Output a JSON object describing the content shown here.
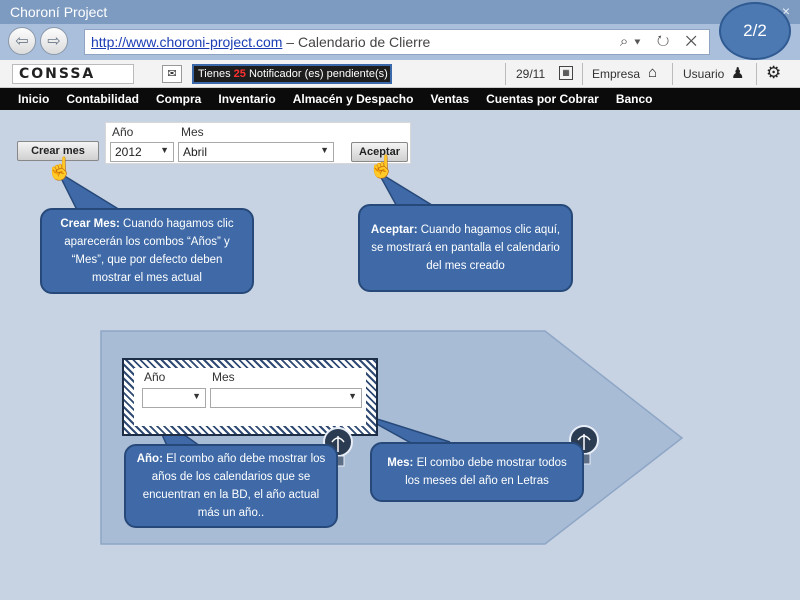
{
  "window": {
    "title": "Choroní Project",
    "close_glyph": "×"
  },
  "addressbar": {
    "url": "http://www.choroni-project.com",
    "separator": " – ",
    "page_title": "Calendario de Clierre",
    "tools": "⌕▾ ↻ ✕"
  },
  "page_badge": "2/2",
  "toolbar": {
    "logo": "CONSSA",
    "notification_prefix": "Tienes",
    "notification_count": "25",
    "notification_suffix": "Notificador (es) pendiente(s)",
    "date": "29/11",
    "empresa_label": "Empresa",
    "usuario_label": "Usuario"
  },
  "menu": [
    "Inicio",
    "Contabilidad",
    "Compra",
    "Inventario",
    "Almacén y Despacho",
    "Ventas",
    "Cuentas por Cobrar",
    "Banco"
  ],
  "form": {
    "crear_mes_label": "Crear mes",
    "anio_label": "Año",
    "mes_label": "Mes",
    "anio_value": "2012",
    "mes_value": "Abril",
    "aceptar_label": "Aceptar"
  },
  "callouts": {
    "crear_mes": {
      "title": "Crear Mes:",
      "text": " Cuando hagamos clic aparecerán los combos “Años” y “Mes”, que por defecto deben mostrar el mes actual"
    },
    "aceptar": {
      "title": "Aceptar:",
      "text": " Cuando hagamos clic aquí, se mostrará en pantalla el calendario del mes creado"
    },
    "anio": {
      "title": "Año:",
      "text": " El combo año debe mostrar los años de los calendarios que se encuentran en la BD, el año actual más un año.."
    },
    "mes": {
      "title": "Mes:",
      "text": " El combo debe mostrar todos los meses del año en Letras"
    }
  },
  "detail": {
    "anio_label": "Año",
    "mes_label": "Mes",
    "anio_value": "",
    "mes_value": ""
  },
  "icons": [
    "back-arrow-icon",
    "forward-arrow-icon",
    "search-icon",
    "refresh-icon",
    "chat-icon",
    "calendar-icon",
    "home-icon",
    "user-icon",
    "gear-icon",
    "pointing-hand-icon",
    "lightbulb-icon"
  ],
  "colors": {
    "titlebar": "#7d9bc1",
    "callout": "#3f6aa7",
    "menubar": "#0b0b0b",
    "notification_count": "#ff3030"
  }
}
